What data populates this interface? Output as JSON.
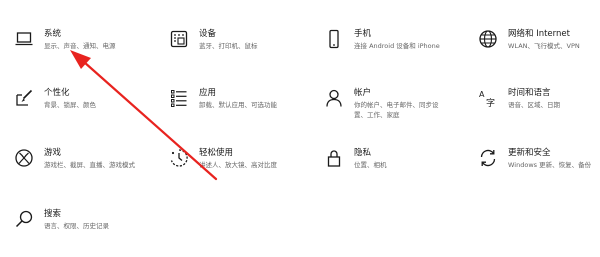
{
  "categories": [
    {
      "id": "system",
      "title": "系统",
      "desc": "显示、声音、通知、电源",
      "icon": "laptop-icon"
    },
    {
      "id": "devices",
      "title": "设备",
      "desc": "蓝牙、打印机、鼠标",
      "icon": "keyboard-printer-icon"
    },
    {
      "id": "phone",
      "title": "手机",
      "desc": "连接 Android 设备和 iPhone",
      "icon": "phone-icon"
    },
    {
      "id": "network",
      "title": "网络和 Internet",
      "desc": "WLAN、飞行模式、VPN",
      "icon": "globe-icon"
    },
    {
      "id": "personalization",
      "title": "个性化",
      "desc": "背景、锁屏、颜色",
      "icon": "paint-icon"
    },
    {
      "id": "apps",
      "title": "应用",
      "desc": "卸载、默认应用、可选功能",
      "icon": "apps-list-icon"
    },
    {
      "id": "accounts",
      "title": "帐户",
      "desc": "你的帐户、电子邮件、同步设置、工作、家庭",
      "icon": "person-icon"
    },
    {
      "id": "time-language",
      "title": "时间和语言",
      "desc": "语音、区域、日期",
      "icon": "language-icon"
    },
    {
      "id": "gaming",
      "title": "游戏",
      "desc": "游戏栏、截屏、直播、游戏模式",
      "icon": "xbox-icon"
    },
    {
      "id": "ease-of-access",
      "title": "轻松使用",
      "desc": "讲述人、放大镜、高对比度",
      "icon": "ease-of-access-icon"
    },
    {
      "id": "privacy",
      "title": "隐私",
      "desc": "位置、相机",
      "icon": "lock-icon"
    },
    {
      "id": "update-security",
      "title": "更新和安全",
      "desc": "Windows 更新、恢复、备份",
      "icon": "sync-icon"
    },
    {
      "id": "search",
      "title": "搜索",
      "desc": "语言、权限、历史记录",
      "icon": "search-icon"
    }
  ],
  "colors": {
    "arrow": "#e8231f",
    "icon": "#1a1a1a"
  }
}
